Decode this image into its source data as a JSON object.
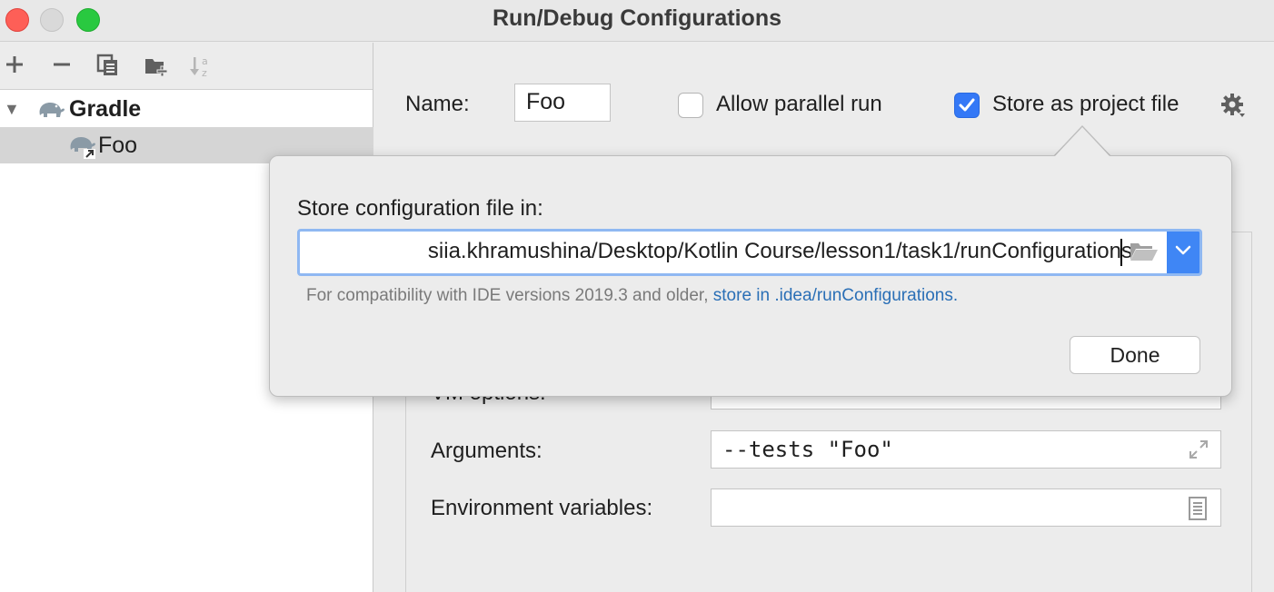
{
  "window": {
    "title": "Run/Debug Configurations"
  },
  "toolbar": {
    "add_icon": "plus-icon",
    "remove_icon": "minus-icon",
    "copy_icon": "copy-icon",
    "folder_icon": "new-folder-icon",
    "sort_icon": "sort-alphabetical-icon"
  },
  "tree": {
    "group_label": "Gradle",
    "items": [
      {
        "label": "Foo",
        "selected": true
      }
    ]
  },
  "form": {
    "name_label": "Name:",
    "name_value": "Foo",
    "allow_parallel_label": "Allow parallel run",
    "allow_parallel_checked": false,
    "store_project_label": "Store as project file",
    "store_project_checked": true,
    "vm_options_label": "VM options:",
    "arguments_label": "Arguments:",
    "arguments_value": "--tests \"Foo\"",
    "env_label": "Environment variables:"
  },
  "popup": {
    "label": "Store configuration file in:",
    "path": "siia.khramushina/Desktop/Kotlin Course/lesson1/task1/runConfigurations",
    "hint_prefix": "For compatibility with IDE versions 2019.3 and older,",
    "hint_link": "store in .idea/runConfigurations.",
    "done_label": "Done"
  },
  "colors": {
    "accent": "#3478f6",
    "link": "#2a6fb6",
    "close": "#fe5f57",
    "maximize": "#29c940"
  }
}
